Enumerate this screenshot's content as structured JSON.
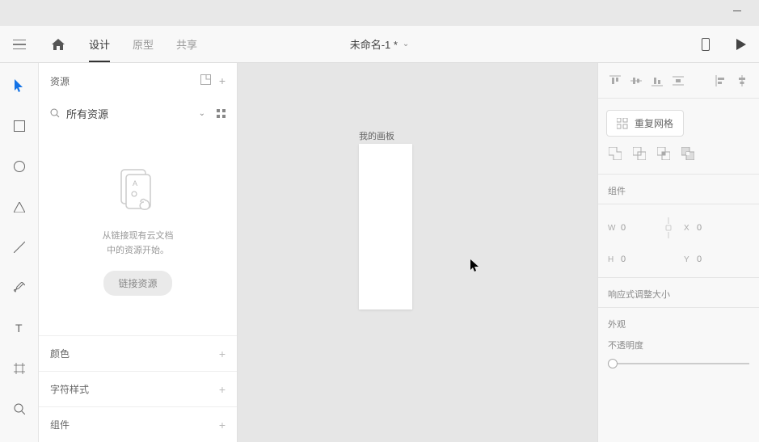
{
  "titlebar": {},
  "topbar": {
    "tabs": [
      {
        "label": "设计",
        "active": true
      },
      {
        "label": "原型",
        "active": false
      },
      {
        "label": "共享",
        "active": false
      }
    ],
    "document_title": "未命名-1 *"
  },
  "leftpanel": {
    "assets_label": "资源",
    "search_label": "所有资源",
    "empty_message_line1": "从链接现有云文档",
    "empty_message_line2": "中的资源开始。",
    "link_button": "链接资源",
    "sections": [
      {
        "label": "颜色"
      },
      {
        "label": "字符样式"
      },
      {
        "label": "组件"
      }
    ]
  },
  "canvas": {
    "artboard_name": "我的画板"
  },
  "rightpanel": {
    "repeat_grid_label": "重复网格",
    "component_label": "组件",
    "transform": {
      "w_label": "W",
      "w_value": "0",
      "h_label": "H",
      "h_value": "0",
      "x_label": "X",
      "x_value": "0",
      "y_label": "Y",
      "y_value": "0"
    },
    "responsive_label": "响应式调整大小",
    "appearance_label": "外观",
    "opacity_label": "不透明度"
  }
}
